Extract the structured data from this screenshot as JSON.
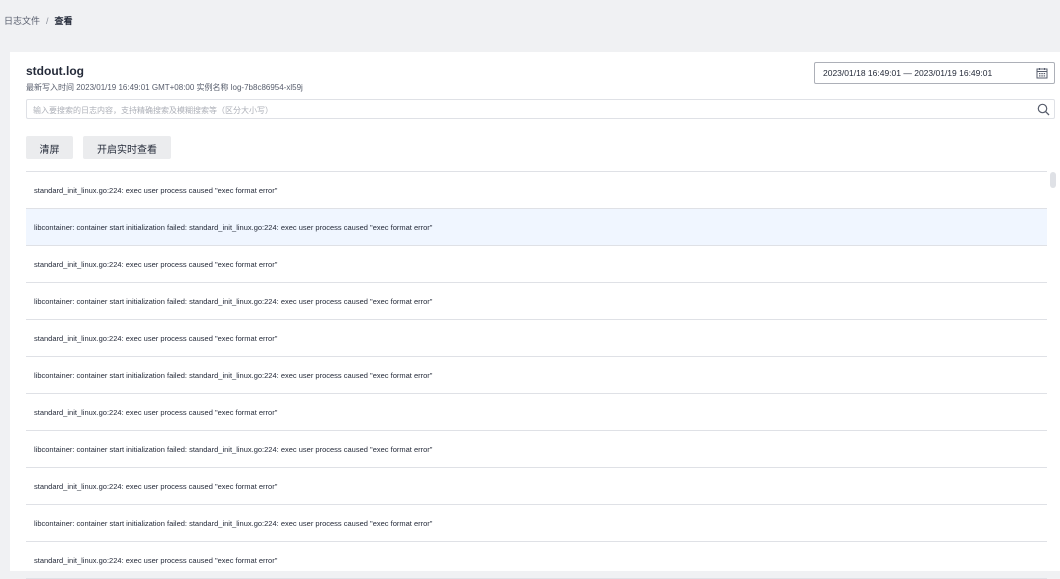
{
  "breadcrumb": {
    "parent": "日志文件",
    "separator": "/",
    "current": "查看"
  },
  "log": {
    "title": "stdout.log",
    "meta": "最新写入时间 2023/01/19 16:49:01 GMT+08:00 实例名称 log-7b8c86954-xl59j"
  },
  "date_range": {
    "value": "2023/01/18 16:49:01 — 2023/01/19 16:49:01",
    "icon": "calendar-icon"
  },
  "search": {
    "placeholder": "输入要搜索的日志内容，支持精确搜索及模糊搜索等（区分大小写）",
    "value": "",
    "icon": "search-icon"
  },
  "buttons": {
    "clear": "清屏",
    "live": "开启实时查看"
  },
  "log_lines": [
    "standard_init_linux.go:224: exec user process caused \"exec format error\"",
    "libcontainer: container start initialization failed: standard_init_linux.go:224: exec user process caused \"exec format error\"",
    "standard_init_linux.go:224: exec user process caused \"exec format error\"",
    "libcontainer: container start initialization failed: standard_init_linux.go:224: exec user process caused \"exec format error\"",
    "standard_init_linux.go:224: exec user process caused \"exec format error\"",
    "libcontainer: container start initialization failed: standard_init_linux.go:224: exec user process caused \"exec format error\"",
    "standard_init_linux.go:224: exec user process caused \"exec format error\"",
    "libcontainer: container start initialization failed: standard_init_linux.go:224: exec user process caused \"exec format error\"",
    "standard_init_linux.go:224: exec user process caused \"exec format error\"",
    "libcontainer: container start initialization failed: standard_init_linux.go:224: exec user process caused \"exec format error\"",
    "standard_init_linux.go:224: exec user process caused \"exec format error\""
  ],
  "colors": {
    "page_bg": "#f0f1f3",
    "row_highlight": "#f0f6ff",
    "border": "#dfe1e6",
    "button_bg": "#ebecee"
  }
}
